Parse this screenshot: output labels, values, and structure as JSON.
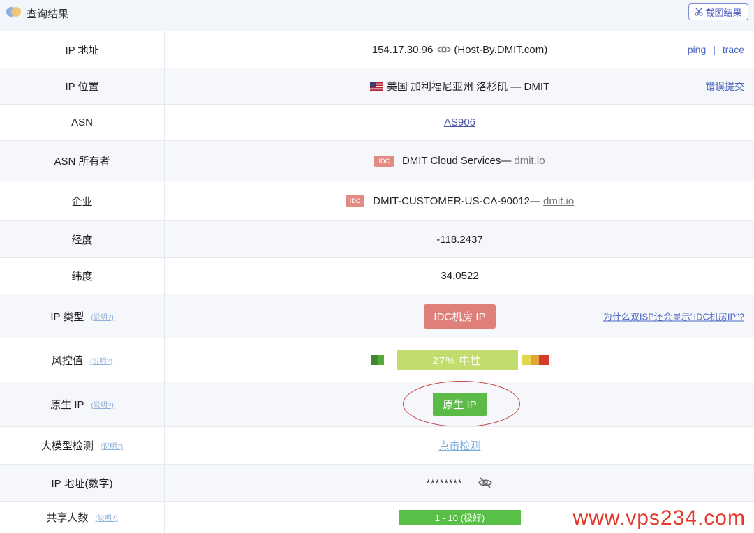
{
  "header": {
    "title": "查询结果",
    "screenshot_label": "截图结果"
  },
  "rows": {
    "ip": {
      "label": "IP 地址",
      "value": "154.17.30.96",
      "host": "(Host-By.DMIT.com)",
      "ping": "ping",
      "sep": "|",
      "trace": "trace"
    },
    "location": {
      "label": "IP 位置",
      "value": "美国 加利福尼亚州 洛杉矶 — DMIT",
      "report": "错误提交"
    },
    "asn": {
      "label": "ASN",
      "value": "AS906"
    },
    "asn_owner": {
      "label": "ASN 所有者",
      "badge": "IDC",
      "value": "DMIT Cloud Services—",
      "domain": "dmit.io"
    },
    "org": {
      "label": "企业",
      "badge": "IDC",
      "value": "DMIT-CUSTOMER-US-CA-90012—",
      "domain": "dmit.io"
    },
    "longitude": {
      "label": "经度",
      "value": "-118.2437"
    },
    "latitude": {
      "label": "纬度",
      "value": "34.0522"
    },
    "ip_type": {
      "label": "IP 类型",
      "help": "(说明?)",
      "value": "IDC机房 IP",
      "question": "为什么双ISP还会显示\"IDC机房IP\"?"
    },
    "risk": {
      "label": "风控值",
      "help": "(说明?)",
      "percent": 27,
      "value": "27%  中性"
    },
    "native": {
      "label": "原生 IP",
      "help": "(说明?)",
      "value": "原生 IP"
    },
    "llm": {
      "label": "大模型检测",
      "help": "(说明?)",
      "value": "点击检测"
    },
    "ip_numeric": {
      "label": "IP 地址(数字)",
      "value": "********"
    },
    "shared": {
      "label": "共享人数",
      "help": "(说明?)",
      "value": "1 - 10 (极好)"
    }
  },
  "watermark": "www.vps234.com",
  "colors": {
    "idc_badge": "#e28b83",
    "type_badge": "#de7f7a",
    "risk_bar": "#c3dd6c",
    "native_badge": "#5bbb46",
    "accent_link": "#4a67c0"
  }
}
